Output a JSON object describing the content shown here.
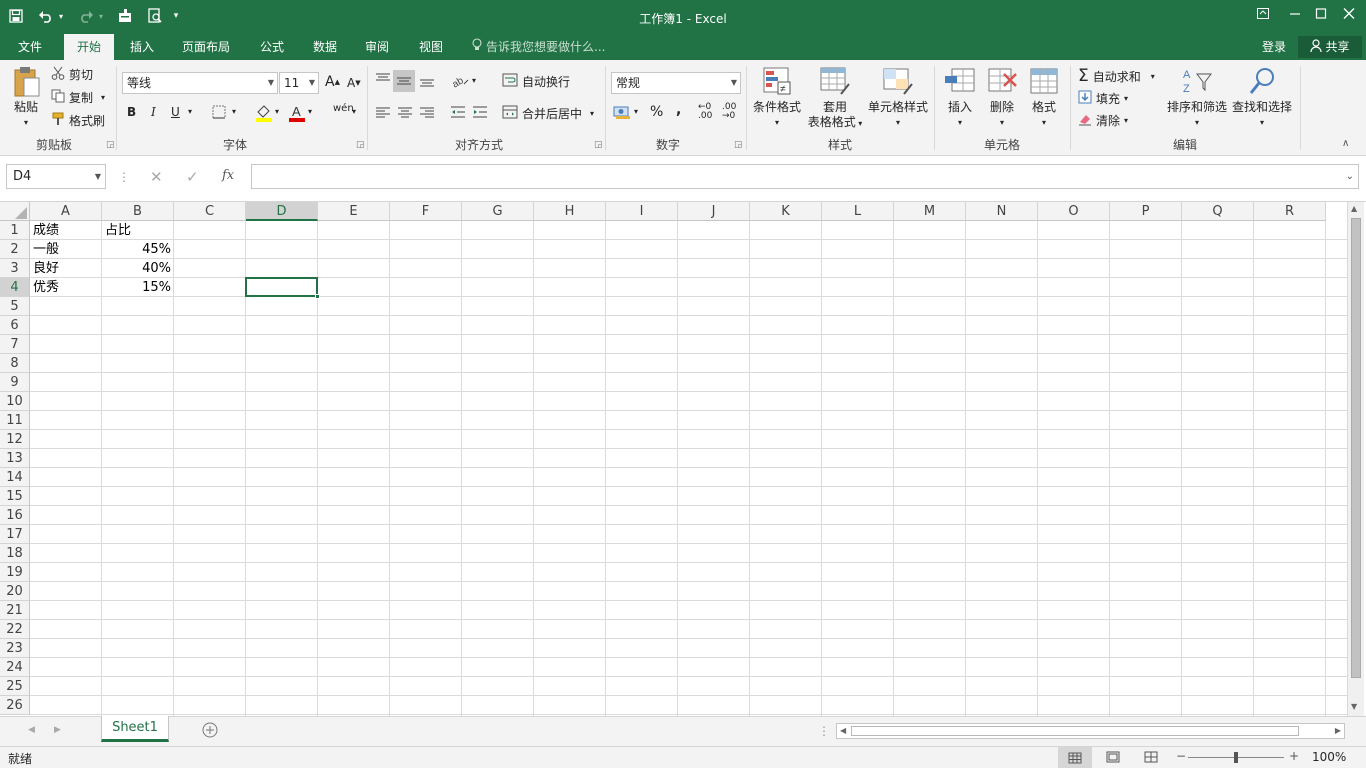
{
  "window": {
    "title": "工作簿1 - Excel"
  },
  "qat": {
    "save_icon": "save-icon",
    "undo_icon": "undo-icon",
    "redo_icon": "redo-icon",
    "touch_icon": "touch-mode-icon",
    "preview_icon": "print-preview-icon",
    "customize": "▾"
  },
  "tabs": [
    {
      "label": "文件"
    },
    {
      "label": "开始"
    },
    {
      "label": "插入"
    },
    {
      "label": "页面布局"
    },
    {
      "label": "公式"
    },
    {
      "label": "数据"
    },
    {
      "label": "审阅"
    },
    {
      "label": "视图"
    }
  ],
  "tellme": {
    "text": "告诉我您想要做什么..."
  },
  "account": {
    "login": "登录",
    "share": "共享"
  },
  "ribbon": {
    "clipboard": {
      "label": "剪贴板",
      "paste": "粘贴",
      "cut": "剪切",
      "copy": "复制",
      "painter": "格式刷"
    },
    "font": {
      "label": "字体",
      "name": "等线",
      "size": "11",
      "bold": "B",
      "italic": "I",
      "underline": "U",
      "grow": "A",
      "shrink": "A",
      "phonetic": "wén"
    },
    "alignment": {
      "label": "对齐方式",
      "wrap": "自动换行",
      "merge": "合并后居中"
    },
    "number": {
      "label": "数字",
      "format": "常规",
      "percent": "%",
      "comma": ","
    },
    "styles": {
      "label": "样式",
      "conditional": "条件格式",
      "table_line1": "套用",
      "table_line2": "表格格式",
      "cell_styles": "单元格样式"
    },
    "cells": {
      "label": "单元格",
      "insert": "插入",
      "delete": "删除",
      "format": "格式"
    },
    "editing": {
      "label": "编辑",
      "autosum": "自动求和",
      "fill": "填充",
      "clear": "清除",
      "sort": "排序和筛选",
      "find": "查找和选择"
    }
  },
  "formula_bar": {
    "name_box": "D4",
    "value": "",
    "fx": "fx"
  },
  "grid": {
    "columns": [
      "A",
      "B",
      "C",
      "D",
      "E",
      "F",
      "G",
      "H",
      "I",
      "J",
      "K",
      "L",
      "M",
      "N",
      "O",
      "P",
      "Q",
      "R"
    ],
    "rows": [
      "1",
      "2",
      "3",
      "4",
      "5",
      "6",
      "7",
      "8",
      "9",
      "10",
      "11",
      "12",
      "13",
      "14",
      "15",
      "16",
      "17",
      "18",
      "19",
      "20",
      "21",
      "22",
      "23",
      "24",
      "25",
      "26"
    ],
    "cells": {
      "A1": "成绩",
      "B1": "占比",
      "A2": "一般",
      "B2": "45%",
      "A3": "良好",
      "B3": "40%",
      "A4": "优秀",
      "B4": "15%"
    },
    "active_cell": "D4"
  },
  "sheets": [
    {
      "name": "Sheet1"
    }
  ],
  "status": {
    "text": "就绪",
    "zoom": "100%",
    "minus": "−",
    "plus": "+"
  },
  "colors": {
    "accent": "#217346",
    "ribbon_bg": "#f3f3f3"
  }
}
